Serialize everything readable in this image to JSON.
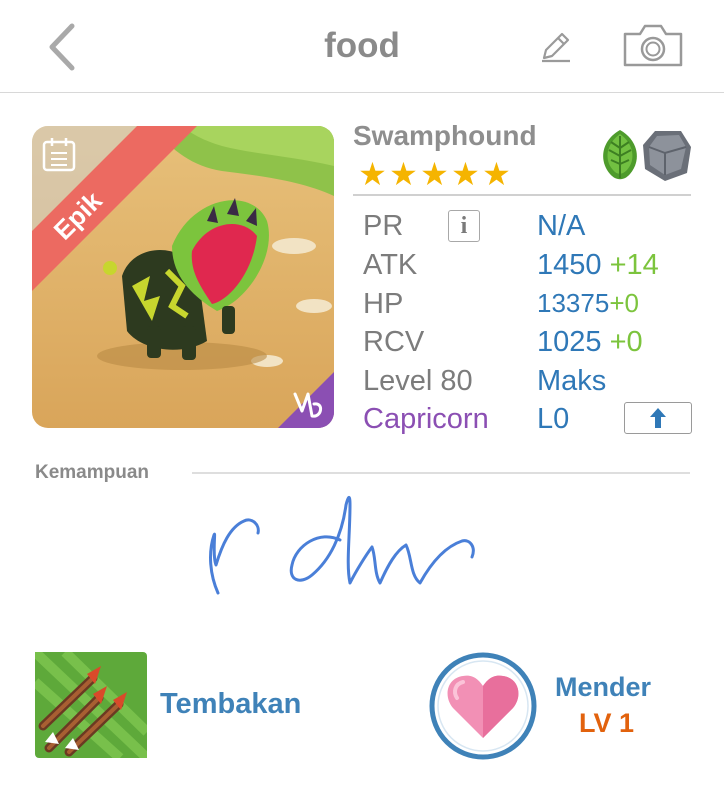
{
  "header": {
    "title": "food",
    "back_icon": "chevron-left-icon",
    "edit_icon": "pencil-icon",
    "camera_icon": "camera-icon"
  },
  "monster": {
    "rarity": "Epik",
    "name": "Swamphound",
    "stars": 5,
    "elements": [
      "leaf-element-icon",
      "rock-element-icon"
    ],
    "zodiac_badge_icon": "capricorn-icon",
    "stats": [
      {
        "key": "pr",
        "label": "PR",
        "value": "N/A",
        "bonus": ""
      },
      {
        "key": "atk",
        "label": "ATK",
        "value": "1450",
        "bonus": "+14"
      },
      {
        "key": "hp",
        "label": "HP",
        "value": "13375",
        "bonus": "+0"
      },
      {
        "key": "rcv",
        "label": "RCV",
        "value": "1025",
        "bonus": "+0"
      },
      {
        "key": "level",
        "label": "Level 80",
        "value": "Maks",
        "bonus": ""
      },
      {
        "key": "zodiac",
        "label": "Capricorn",
        "value": "L0",
        "bonus": ""
      }
    ],
    "info_glyph": "i",
    "upgrade_icon": "arrow-up-icon"
  },
  "abilities": {
    "section_title": "Kemampuan",
    "skill": {
      "name": "Tembakan",
      "icon": "arrows-skill-icon"
    },
    "rune": {
      "name": "Mender",
      "level": "LV 1",
      "icon": "heart-rune-icon"
    }
  },
  "colors": {
    "accent_blue": "#2f78b7",
    "bonus_green": "#7cc43d",
    "zodiac_purple": "#8b4fb3",
    "level_orange": "#e2620d",
    "star_gold": "#f5b400",
    "rarity_red": "#ec6a61"
  }
}
